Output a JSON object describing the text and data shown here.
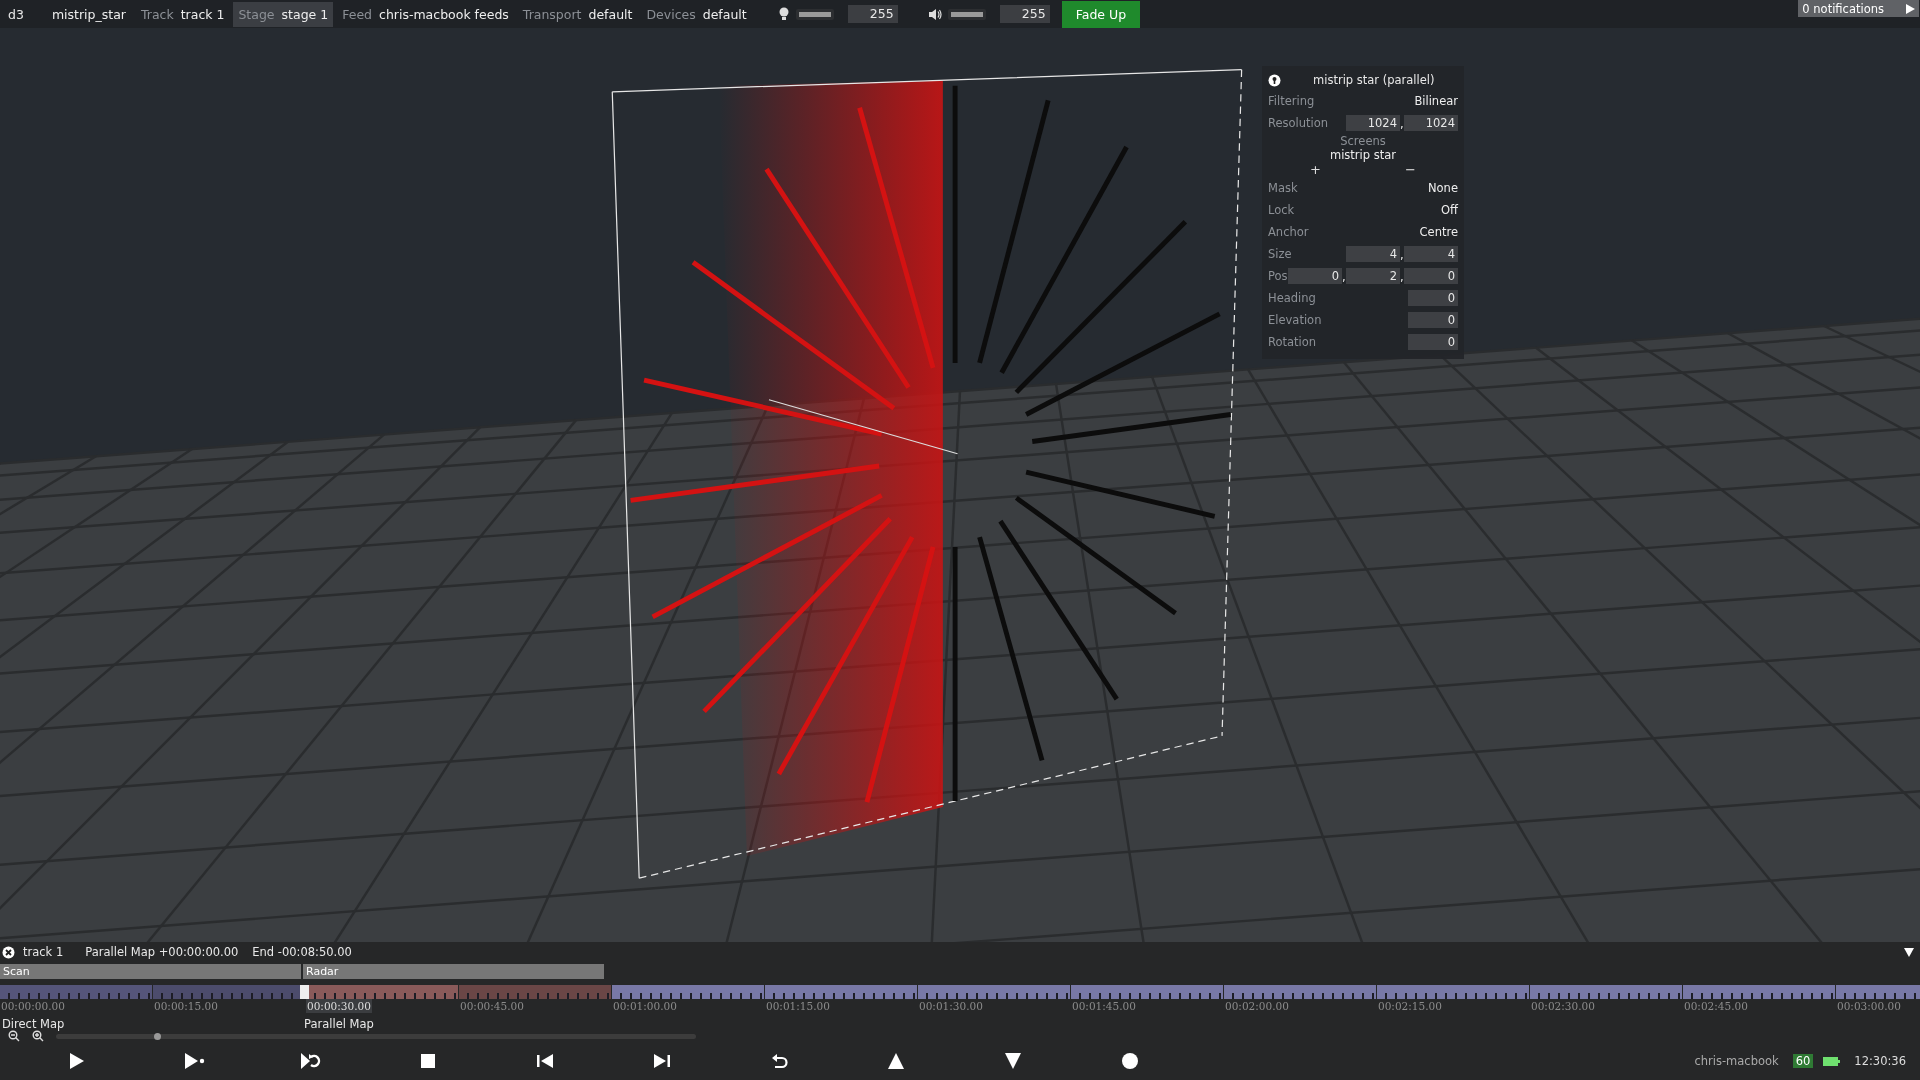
{
  "top_bar": {
    "app": "d3",
    "project": "mistrip_star",
    "fields": [
      {
        "label": "Track",
        "value": "track 1",
        "selected": false
      },
      {
        "label": "Stage",
        "value": "stage 1",
        "selected": true
      },
      {
        "label": "Feed",
        "value": "chris-macbook feeds",
        "selected": false
      },
      {
        "label": "Transport",
        "value": "default",
        "selected": false
      },
      {
        "label": "Devices",
        "value": "default",
        "selected": false
      }
    ],
    "brightness": {
      "level": 1,
      "reading": "255"
    },
    "volume": {
      "level": 1,
      "reading": "255"
    },
    "fade_button": "Fade Up",
    "notifications": "0 notifications"
  },
  "properties": {
    "title": "mistrip star (parallel)",
    "separator": ",",
    "rows": [
      {
        "kind": "choice",
        "label": "Filtering",
        "value": "Bilinear"
      },
      {
        "kind": "fields",
        "label": "Resolution",
        "values": [
          "1024",
          "1024"
        ]
      },
      {
        "kind": "list",
        "heading": "Screens",
        "items": [
          "mistrip star"
        ],
        "add": "+",
        "remove": "−"
      },
      {
        "kind": "choice",
        "label": "Mask",
        "value": "None"
      },
      {
        "kind": "choice",
        "label": "Lock",
        "value": "Off"
      },
      {
        "kind": "choice",
        "label": "Anchor",
        "value": "Centre"
      },
      {
        "kind": "fields",
        "label": "Size",
        "values": [
          "4",
          "4"
        ]
      },
      {
        "kind": "fields",
        "label": "Pos",
        "values": [
          "0",
          "2",
          "0"
        ]
      },
      {
        "kind": "fields",
        "label": "Heading",
        "values": [
          "0"
        ]
      },
      {
        "kind": "fields",
        "label": "Elevation",
        "values": [
          "0"
        ]
      },
      {
        "kind": "fields",
        "label": "Rotation",
        "values": [
          "0"
        ]
      }
    ]
  },
  "timeline": {
    "track": "track 1",
    "position": "Parallel Map +00:00:00.00",
    "end": "End -00:08:50.00",
    "sections": [
      {
        "name": "Scan",
        "layer": "Direct Map"
      },
      {
        "name": "Radar",
        "layer": "Parallel Map"
      }
    ],
    "segments": [
      {
        "color": "#55557a"
      },
      {
        "color": "#4c4c6c"
      },
      {
        "color": "#8a5a5a"
      },
      {
        "color": "#6a4646"
      },
      {
        "color": "#7878a6"
      },
      {
        "color": "#7878a6"
      },
      {
        "color": "#7878a6"
      },
      {
        "color": "#7878a6"
      },
      {
        "color": "#7878a6"
      },
      {
        "color": "#7878a6"
      },
      {
        "color": "#7878a6"
      },
      {
        "color": "#7878a6"
      },
      {
        "color": "#7878a6"
      }
    ],
    "ticks": [
      {
        "label": "00:00:00.00",
        "selected": false
      },
      {
        "label": "00:00:15.00",
        "selected": false
      },
      {
        "label": "00:00:30.00",
        "selected": true
      },
      {
        "label": "00:00:45.00",
        "selected": false
      },
      {
        "label": "00:01:00.00",
        "selected": false
      },
      {
        "label": "00:01:15.00",
        "selected": false
      },
      {
        "label": "00:01:30.00",
        "selected": false
      },
      {
        "label": "00:01:45.00",
        "selected": false
      },
      {
        "label": "00:02:00.00",
        "selected": false
      },
      {
        "label": "00:02:15.00",
        "selected": false
      },
      {
        "label": "00:02:30.00",
        "selected": false
      },
      {
        "label": "00:02:45.00",
        "selected": false
      },
      {
        "label": "00:03:00.00",
        "selected": false
      }
    ]
  },
  "transport": [
    {
      "kind": "play"
    },
    {
      "kind": "play-next"
    },
    {
      "kind": "loop"
    },
    {
      "kind": "stop"
    },
    {
      "kind": "prev"
    },
    {
      "kind": "next"
    },
    {
      "kind": "undo"
    },
    {
      "kind": "up"
    },
    {
      "kind": "down"
    },
    {
      "kind": "record"
    }
  ],
  "status": {
    "machine": "chris-macbook",
    "fps": "60",
    "time": "12:30:36"
  }
}
